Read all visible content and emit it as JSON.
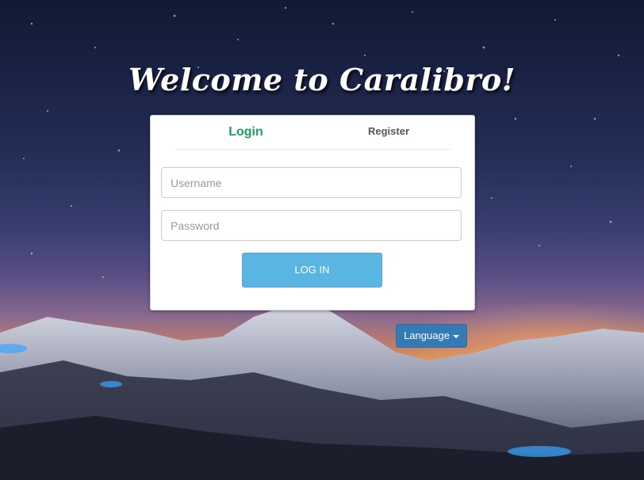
{
  "header": {
    "title": "Welcome to Caralibro!"
  },
  "tabs": {
    "login": "Login",
    "register": "Register"
  },
  "form": {
    "username_placeholder": "Username",
    "password_placeholder": "Password",
    "submit_label": "LOG IN"
  },
  "language": {
    "label": "Language"
  },
  "colors": {
    "accent_green": "#17a05d",
    "login_button": "#5bb5e2",
    "language_button": "#337ab7"
  },
  "icons": {
    "language_caret": "caret-down-icon"
  }
}
